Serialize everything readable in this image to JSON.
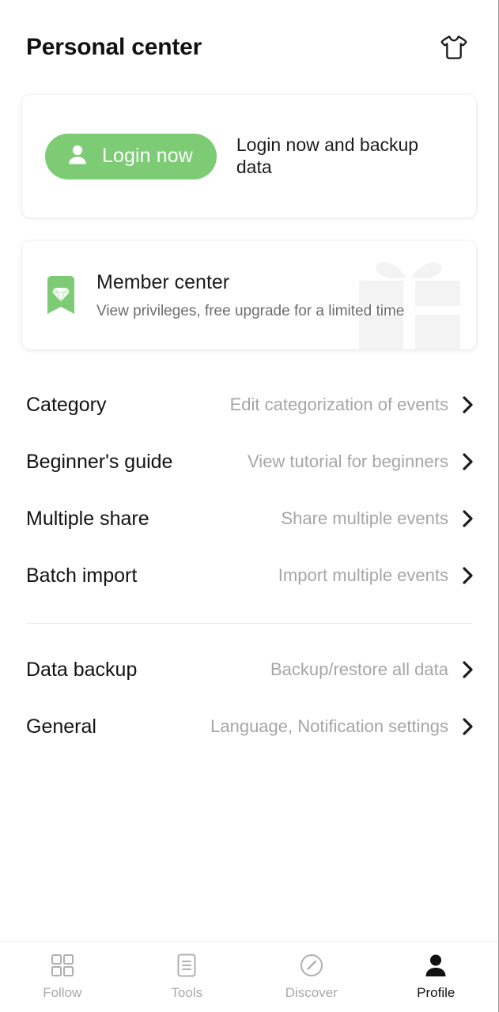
{
  "header": {
    "title": "Personal center",
    "theme_icon": "tshirt-icon"
  },
  "login_card": {
    "button_label": "Login now",
    "button_icon": "person-icon",
    "hint": "Login now and backup data",
    "button_color": "#7ECB76"
  },
  "member_card": {
    "badge_icon": "diamond-badge-icon",
    "title": "Member center",
    "subtitle": "View privileges, free upgrade for a limited time",
    "watermark_icon": "gift-box-icon",
    "badge_color": "#7ECB76"
  },
  "menu": {
    "group_one": [
      {
        "label": "Category",
        "value": "Edit categorization of events",
        "chevron": "chevron-right-icon"
      },
      {
        "label": "Beginner's guide",
        "value": "View tutorial for beginners",
        "chevron": "chevron-right-icon"
      },
      {
        "label": "Multiple share",
        "value": "Share multiple events",
        "chevron": "chevron-right-icon"
      },
      {
        "label": "Batch import",
        "value": "Import multiple events",
        "chevron": "chevron-right-icon"
      }
    ],
    "group_two": [
      {
        "label": "Data backup",
        "value": "Backup/restore all data",
        "chevron": "chevron-right-icon"
      },
      {
        "label": "General",
        "value": "Language, Notification settings",
        "chevron": "chevron-right-icon"
      }
    ]
  },
  "bottom_nav": {
    "items": [
      {
        "label": "Follow",
        "icon": "grid-icon",
        "active": false
      },
      {
        "label": "Tools",
        "icon": "document-lines-icon",
        "active": false
      },
      {
        "label": "Discover",
        "icon": "compass-icon",
        "active": false
      },
      {
        "label": "Profile",
        "icon": "person-filled-icon",
        "active": true
      }
    ]
  }
}
